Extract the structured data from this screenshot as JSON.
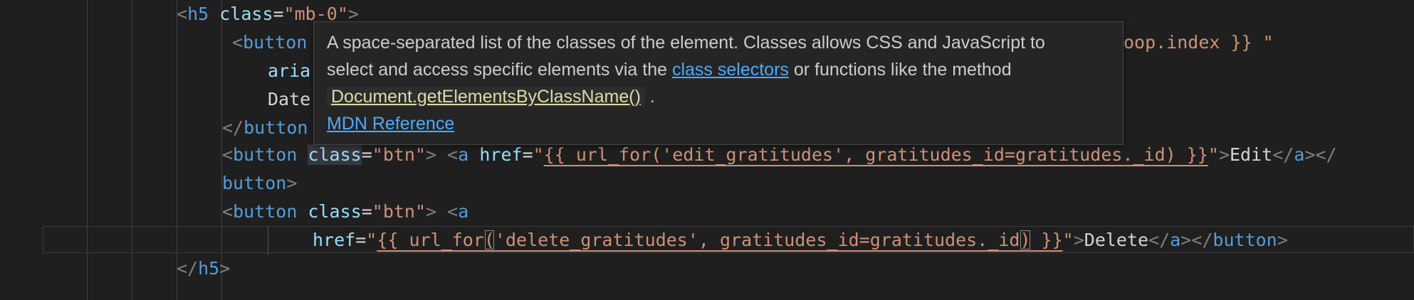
{
  "code": {
    "l1": {
      "open": "<",
      "tag": "h5",
      "attr": "class",
      "eq": "=",
      "val": "\"mb-0\"",
      "close": ">"
    },
    "l2": {
      "open": "<",
      "tag": "button",
      "tail": "oop.index }} \""
    },
    "l3": {
      "attr_fragment": "aria"
    },
    "l4": {
      "text_fragment": "Date"
    },
    "l5": {
      "open": "</",
      "tag": "button"
    },
    "l6": {
      "open1": "<",
      "tag1": "button",
      "attr1": "class",
      "eq1": "=",
      "val1": "\"btn\"",
      "close1": ">",
      "open2": "<",
      "tag2": "a",
      "attr2": "href",
      "eq2": "=",
      "q1": "\"",
      "url": "{{ url_for('edit_gratitudes', gratitudes_id=gratitudes._id) }}",
      "q2": "\"",
      "close2": ">",
      "text": "Edit",
      "end1": "</",
      "endtag": "a",
      "end2": "></"
    },
    "l7": {
      "tag": "button",
      "close": ">"
    },
    "l8": {
      "open1": "<",
      "tag1": "button",
      "attr1": "class",
      "eq1": "=",
      "val1": "\"btn\"",
      "close1": ">",
      "open2": "<",
      "tag2": "a"
    },
    "l9": {
      "attr": "href",
      "eq": "=",
      "q1": "\"",
      "url_a": "{{ url_for",
      "paren_open": "(",
      "url_b": "'delete_gratitudes', gratitudes_id=gratitudes._id",
      "paren_close": ")",
      "url_c": " }}",
      "q2": "\"",
      "close": ">",
      "text": "Delete",
      "end1": "</",
      "endtag1": "a",
      "end2": "></",
      "endtag2": "button",
      "end3": ">"
    },
    "l10": {
      "open": "</",
      "tag": "h5",
      "close": ">"
    }
  },
  "hover": {
    "line1": "A space-separated list of the classes of the element. Classes allows CSS and JavaScript to",
    "line2_pre": "select and access specific elements via the ",
    "line2_link": "class selectors",
    "line2_post": " or functions like the method",
    "chip_a": "Document",
    "chip_b": ".getElementsByClassName()",
    "line3_post": " .",
    "mdn": "MDN Reference"
  },
  "colors": {
    "background": "#1f1f1f",
    "tag": "#569cd6",
    "attribute": "#9cdcfe",
    "string": "#ce9178",
    "link": "#4daafc"
  }
}
